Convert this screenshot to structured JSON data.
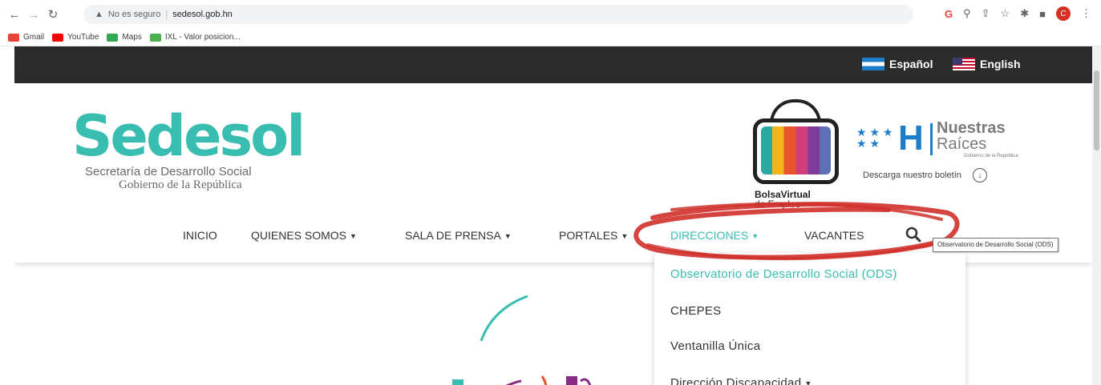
{
  "browser": {
    "security_label": "No es seguro",
    "url": "sedesol.gob.hn",
    "profile_initial": "C"
  },
  "bookmarks": [
    {
      "label": "Gmail",
      "icon": "gmail-icon",
      "color": "#ea4335"
    },
    {
      "label": "YouTube",
      "icon": "youtube-icon",
      "color": "#ff0000"
    },
    {
      "label": "Maps",
      "icon": "maps-icon",
      "color": "#34a853"
    },
    {
      "label": "IXL - Valor posicion...",
      "icon": "ixl-icon",
      "color": "#4caf50"
    }
  ],
  "topbar": {
    "lang_es": "Español",
    "lang_en": "English"
  },
  "logo": {
    "word": "Sedesol",
    "subtitle1": "Secretaría de Desarrollo Social",
    "subtitle2": "Gobierno de la República"
  },
  "bolsa": {
    "line1": "BolsaVirtual",
    "line2": "de Empleo"
  },
  "raices": {
    "line1": "Nuestras",
    "line2": "Raíces",
    "line3": "Gobierno de la República",
    "boletin": "Descarga nuestro boletín"
  },
  "menu": {
    "inicio": "INICIO",
    "quienes": "QUIENES SOMOS",
    "prensa": "SALA DE PRENSA",
    "portales": "PORTALES",
    "direcciones": "DIRECCIONES",
    "vacantes": "VACANTES"
  },
  "dropdown": {
    "items": [
      "Observatorio de Desarrollo Social (ODS)",
      "CHEPES",
      "Ventanilla Única",
      "Dirección Discapacidad"
    ],
    "tooltip": "Observatorio de Desarrollo Social (ODS)"
  },
  "colors": {
    "accent": "#38bdb0",
    "topbar": "#2b2b2b",
    "annotation": "#d0302a"
  }
}
